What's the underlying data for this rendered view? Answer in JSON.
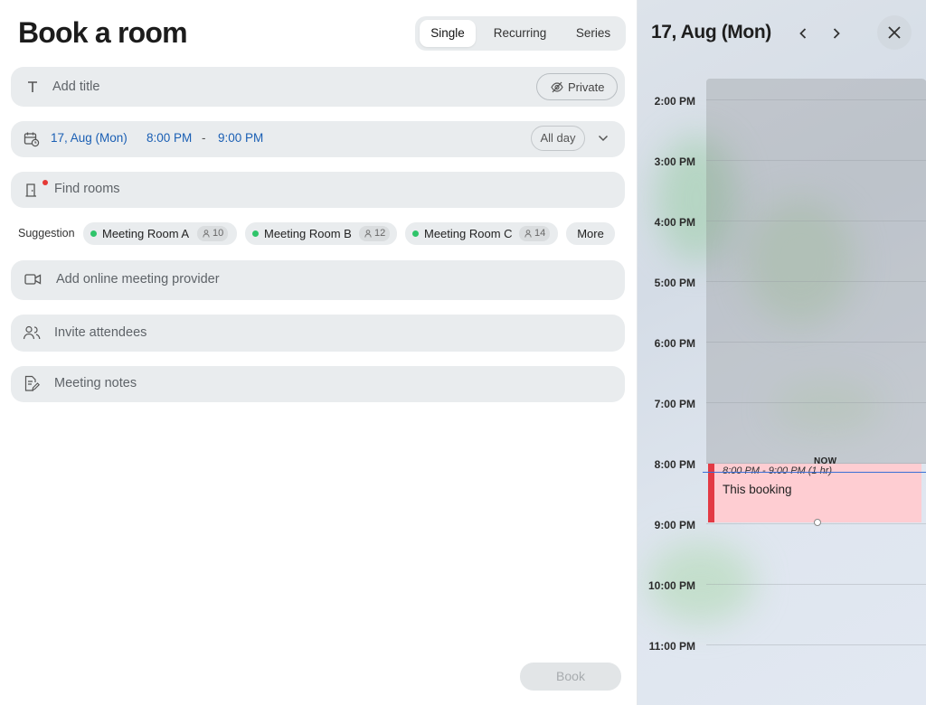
{
  "form": {
    "title": "Book a room",
    "modes": [
      "Single",
      "Recurring",
      "Series"
    ],
    "title_placeholder": "Add title",
    "private_label": "Private",
    "date": "17, Aug (Mon)",
    "start_time": "8:00 PM",
    "time_separator": "-",
    "end_time": "9:00 PM",
    "all_day_label": "All day",
    "find_rooms_placeholder": "Find rooms",
    "suggestion_label": "Suggestion",
    "suggestions": [
      {
        "name": "Meeting Room A",
        "capacity": "10"
      },
      {
        "name": "Meeting Room B",
        "capacity": "12"
      },
      {
        "name": "Meeting Room C",
        "capacity": "14"
      }
    ],
    "more_label": "More",
    "online_meeting_placeholder": "Add online meeting provider",
    "attendees_placeholder": "Invite attendees",
    "notes_placeholder": "Meeting notes",
    "book_label": "Book"
  },
  "calendar": {
    "date_header": "17, Aug (Mon)",
    "hours": [
      "2:00 PM",
      "3:00 PM",
      "4:00 PM",
      "5:00 PM",
      "6:00 PM",
      "7:00 PM",
      "8:00 PM",
      "9:00 PM",
      "10:00 PM",
      "11:00 PM"
    ],
    "now_label": "NOW",
    "booking": {
      "time": "8:00 PM - 9:00 PM (1 hr)",
      "title": "This booking"
    }
  },
  "colors": {
    "accent_blue": "#1a5fb4",
    "available_dot": "#2fc46a",
    "booking_fill": "#fecdd2",
    "booking_bar": "#e33a44",
    "now_line": "#3b6fd6"
  }
}
